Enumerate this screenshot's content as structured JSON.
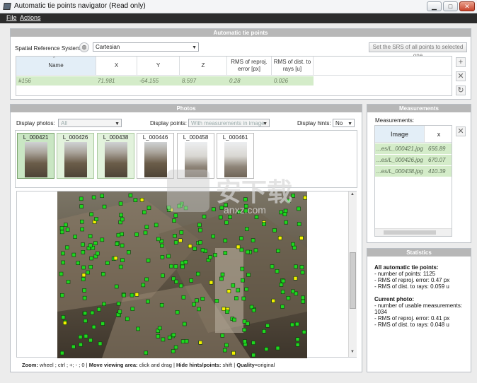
{
  "window": {
    "title": "Automatic tie points navigator (Read only)",
    "min": "▁",
    "max": "□",
    "close": "✕"
  },
  "menu": {
    "file": "File",
    "actions": "Actions"
  },
  "atp": {
    "header": "Automatic tie points",
    "srs_label": "Spatial Reference System",
    "srs_value": "Cartesian",
    "set_srs_button": "Set the SRS of all points to selected one",
    "columns": [
      "Name",
      "X",
      "Y",
      "Z",
      "RMS of reproj. error [px]",
      "RMS of dist. to rays [u]"
    ],
    "row": {
      "name": "#156",
      "x": "71.981",
      "y": "-64.155",
      "z": "8.597",
      "rms_reproj": "0.28",
      "rms_dist": "0.026"
    },
    "add_icon": "+",
    "remove_icon": "✕",
    "refresh_icon": "↻"
  },
  "photos": {
    "header": "Photos",
    "display_photos_label": "Display photos:",
    "display_photos_value": "All",
    "display_points_label": "Display points:",
    "display_points_value": "With measurements in image",
    "display_hints_label": "Display hints:",
    "display_hints_value": "No",
    "thumbs": [
      "L_000421",
      "L_000426",
      "L_000438",
      "L_000446",
      "L_000458",
      "L_000461"
    ],
    "status": {
      "zoom_label": "Zoom:",
      "zoom_text": "wheel ; ctrl ; +; - ; 0  |",
      "move_label": "Move viewing area:",
      "move_text": "click and drag  |",
      "hide_label": "Hide hints/points:",
      "hide_text": "shift  |",
      "quality_label": "Quality",
      "quality_text": "=original"
    }
  },
  "measurements": {
    "header": "Measurements",
    "label": "Measurements:",
    "col_image": "Image",
    "col_x": "x",
    "rows": [
      {
        "image": "...es/L_000421.jpg",
        "x": "656.89"
      },
      {
        "image": "...es/L_000426.jpg",
        "x": "670.07"
      },
      {
        "image": "...es/L_000438.jpg",
        "x": "410.39"
      }
    ],
    "remove_icon": "✕"
  },
  "statistics": {
    "header": "Statistics",
    "all_title": "All automatic tie points:",
    "all_lines": [
      "- number of points: 1125",
      "- RMS of reproj. error: 0.47 px",
      "- RMS of dist. to rays: 0.059 u"
    ],
    "current_title": "Current photo:",
    "current_lines": [
      "- number of usable measurements:",
      "1034",
      "- RMS of reproj. error: 0.41 px",
      "- RMS of dist. to rays: 0.048 u"
    ]
  },
  "watermark": {
    "main": "安下载",
    "sub": "anxz.com"
  }
}
